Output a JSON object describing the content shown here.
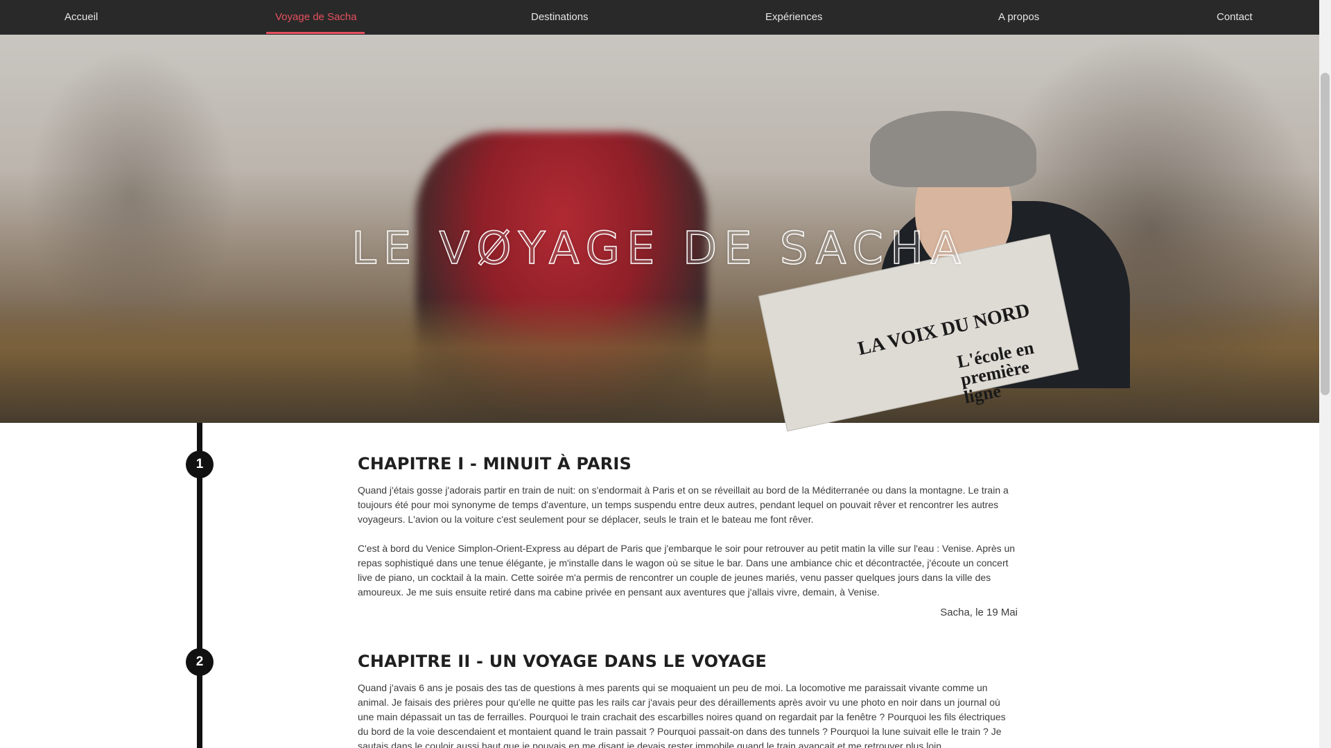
{
  "nav": {
    "items": [
      {
        "label": "Accueil"
      },
      {
        "label": "Voyage de Sacha"
      },
      {
        "label": "Destinations"
      },
      {
        "label": "Expériences"
      },
      {
        "label": "A propos"
      },
      {
        "label": "Contact"
      }
    ],
    "active_index": 1
  },
  "hero": {
    "title": "LE VØYAGE DE SACHA",
    "newspaper_title": "LA VOIX DU NORD",
    "newspaper_headline": "L'école en première ligne"
  },
  "chapters": [
    {
      "number": "1",
      "title": "CHAPITRE I - MINUIT À PARIS",
      "paragraphs": [
        "Quand j'étais gosse j'adorais partir en train de nuit: on s'endormait à Paris et on se réveillait au bord de la Méditerranée ou dans la montagne. Le train a toujours été pour moi synonyme de temps d'aventure, un temps suspendu entre deux autres, pendant lequel on pouvait rêver et rencontrer les autres voyageurs. L'avion ou la voiture c'est seulement pour se déplacer, seuls le train et le bateau me font rêver.",
        "C'est à bord du Venice Simplon-Orient-Express au départ de Paris que j'embarque le soir pour retrouver au petit matin la ville sur l'eau : Venise. Après un repas sophistiqué dans une tenue élégante, je m'installe dans le wagon où se situe le bar. Dans une ambiance chic et décontractée, j'écoute un concert live de piano, un cocktail à la main. Cette soirée m'a permis de rencontrer un couple de jeunes mariés, venu passer quelques jours dans la ville des amoureux. Je me suis ensuite retiré dans ma cabine privée en pensant aux aventures que j'allais vivre, demain, à Venise."
      ],
      "signature": "Sacha, le 19 Mai"
    },
    {
      "number": "2",
      "title": "CHAPITRE II - UN VOYAGE DANS LE VOYAGE",
      "paragraphs": [
        "Quand j'avais 6 ans je posais des tas de questions à mes parents qui se moquaient un peu de moi. La locomotive me paraissait vivante comme un animal. Je faisais des prières pour qu'elle ne quitte pas les rails car j'avais peur des déraillements après avoir vu une photo en noir dans un journal où une main dépassait un tas de ferrailles. Pourquoi le train crachait des escarbilles noires quand on regardait par la fenêtre ? Pourquoi les fils électriques du bord de la voie descendaient et montaient quand le train passait ? Pourquoi passait-on dans des tunnels ? Pourquoi la lune suivait elle le train ? Je sautais dans le couloir aussi haut que je pouvais en me disant je devais rester immobile quand le train avançait et me retrouver plus loin"
      ]
    }
  ]
}
